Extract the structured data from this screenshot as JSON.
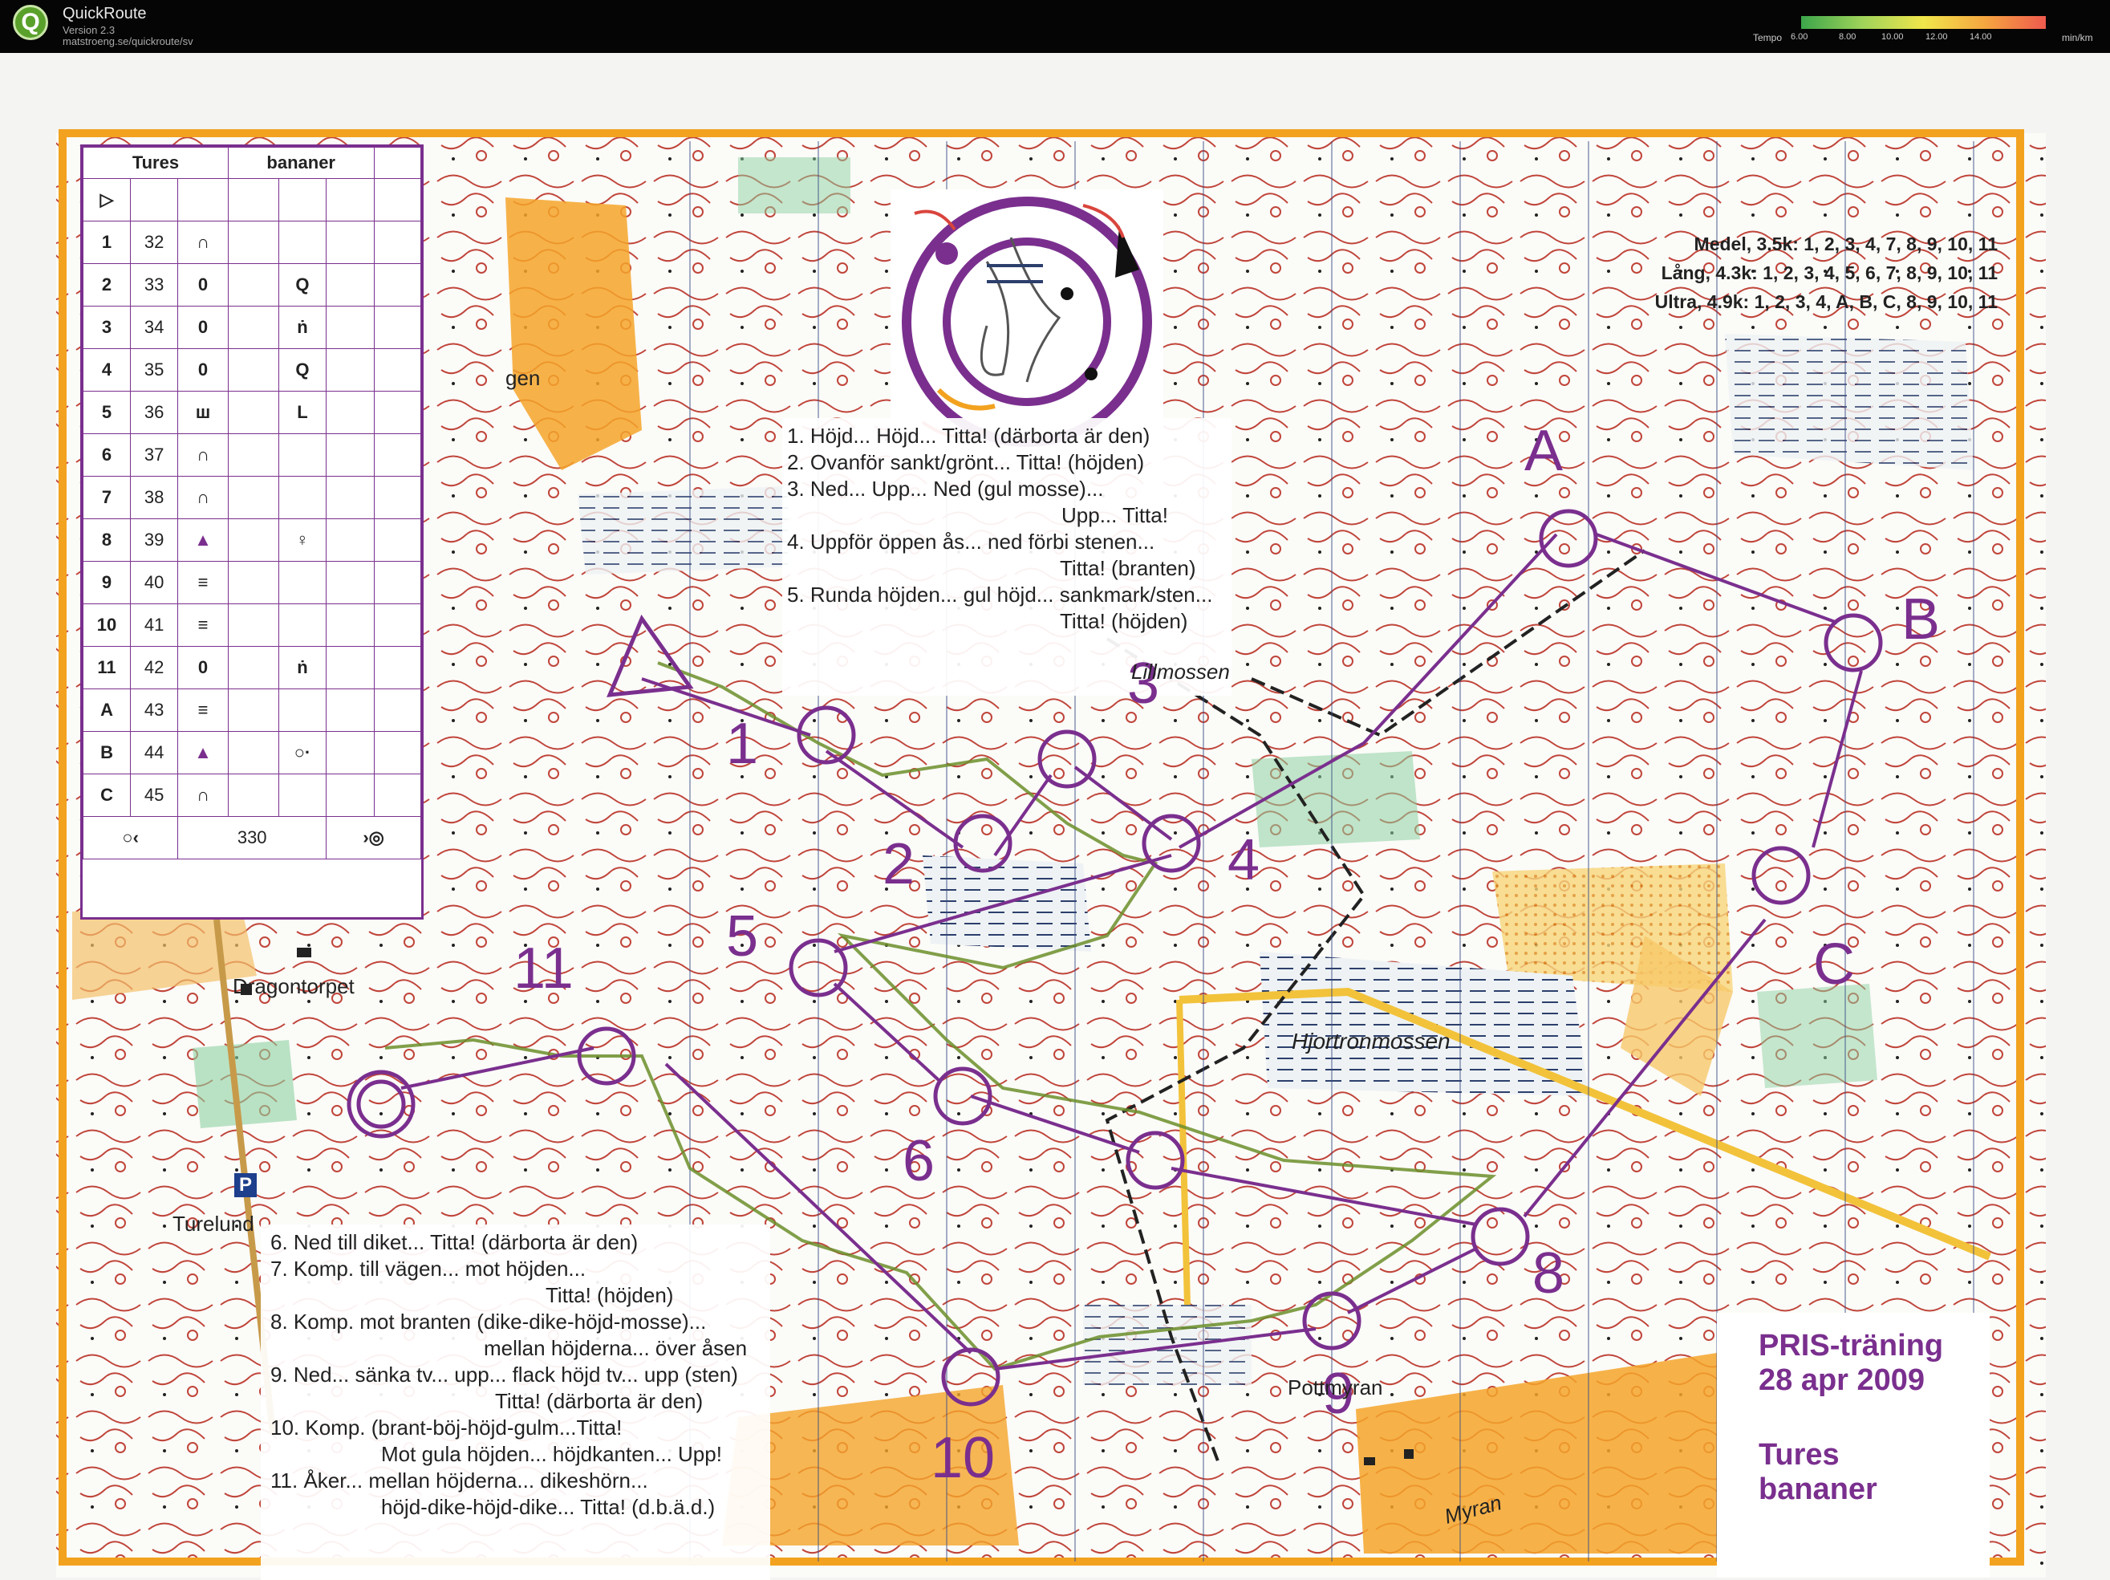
{
  "app": {
    "name": "QuickRoute",
    "version": "Version 2.3",
    "url": "matstroeng.se/quickroute/sv",
    "tempo_label": "Tempo",
    "tempo_ticks": [
      "6.00",
      "8.00",
      "10.00",
      "12.00",
      "14.00"
    ],
    "tempo_unit": "min/km",
    "colors": {
      "slow": "#ef5a4e",
      "fast": "#3ca64a",
      "course": "#7a2f8e",
      "route": "#6b8e2a"
    }
  },
  "legend": {
    "header": [
      "Tures",
      "bananer"
    ],
    "start_symbol": "▷",
    "rows": [
      {
        "n": "1",
        "code": "32",
        "sym": "∩",
        "extra": ""
      },
      {
        "n": "2",
        "code": "33",
        "sym": "0",
        "extra": "Q"
      },
      {
        "n": "3",
        "code": "34",
        "sym": "0",
        "extra": "ṅ"
      },
      {
        "n": "4",
        "code": "35",
        "sym": "0",
        "extra": "Q"
      },
      {
        "n": "5",
        "code": "36",
        "sym": "ш",
        "extra": "L"
      },
      {
        "n": "6",
        "code": "37",
        "sym": "∩",
        "extra": ""
      },
      {
        "n": "7",
        "code": "38",
        "sym": "∩",
        "extra": ""
      },
      {
        "n": "8",
        "code": "39",
        "sym": "▲",
        "extra": "♀"
      },
      {
        "n": "9",
        "code": "40",
        "sym": "≡",
        "extra": ""
      },
      {
        "n": "10",
        "code": "41",
        "sym": "≡",
        "extra": ""
      },
      {
        "n": "11",
        "code": "42",
        "sym": "0",
        "extra": "ṅ"
      },
      {
        "n": "A",
        "code": "43",
        "sym": "≡",
        "extra": ""
      },
      {
        "n": "B",
        "code": "44",
        "sym": "▲",
        "extra": "○·"
      },
      {
        "n": "C",
        "code": "45",
        "sym": "∩",
        "extra": ""
      }
    ],
    "footer_left": "○‹",
    "footer_distance": "330",
    "footer_right": "›◎"
  },
  "variants": [
    "Medel, 3.5k: 1, 2, 3, 4,   7, 8, 9, 10, 11",
    "Lång, 4.3k: 1, 2, 3, 4, 5, 6, 7, 8, 9, 10, 11",
    "Ultra, 4.9k: 1, 2, 3, 4,   A, B, C,   8, 9, 10, 11"
  ],
  "notes_top": [
    "1. Höjd... Höjd... Titta! (därborta är den)",
    "2. Ovanför sankt/grönt... Titta! (höjden)",
    "3. Ned... Upp... Ned (gul mosse)...",
    "Upp... Titta!",
    "4. Uppför öppen ås... ned förbi stenen...",
    "Titta! (branten)",
    "5. Runda höjden... gul höjd... sankmark/sten...",
    "Titta! (höjden)"
  ],
  "notes_bottom": [
    "6. Ned till diket... Titta! (därborta är den)",
    "7. Komp. till vägen... mot höjden...",
    "Titta! (höjden)",
    "8. Komp. mot branten (dike-dike-höjd-mosse)...",
    "mellan höjderna... över åsen",
    "9. Ned... sänka tv... upp... flack höjd tv... upp (sten)",
    "Titta! (därborta är den)",
    "10. Komp. (brant-böj-höjd-gulm...Titta!",
    "Mot gula höjden... höjdkanten... Upp!",
    "11. Åker... mellan höjderna... dikeshörn...",
    "höjd-dike-höjd-dike... Titta! (d.b.ä.d.)"
  ],
  "title_block": {
    "line1": "PRIS-träning",
    "line2": "28 apr 2009",
    "line3": "Tures",
    "line4": "bananer"
  },
  "places": {
    "lillmossen": "Lillmossen",
    "hjortronmossen": "Hjortronmossen",
    "dragontorpet": "Dragontorpet",
    "turelund": "Turelund",
    "pottmyran": "Pottmyran",
    "myran": "Myran",
    "gen": "gen",
    "parking": "P"
  },
  "controls": {
    "c1": "1",
    "c2": "2",
    "c3": "3",
    "c4": "4",
    "c5": "5",
    "c6": "6",
    "c8": "8",
    "c9": "9",
    "c10": "10",
    "c11": "11",
    "cA": "A",
    "cB": "B",
    "cC": "C"
  }
}
